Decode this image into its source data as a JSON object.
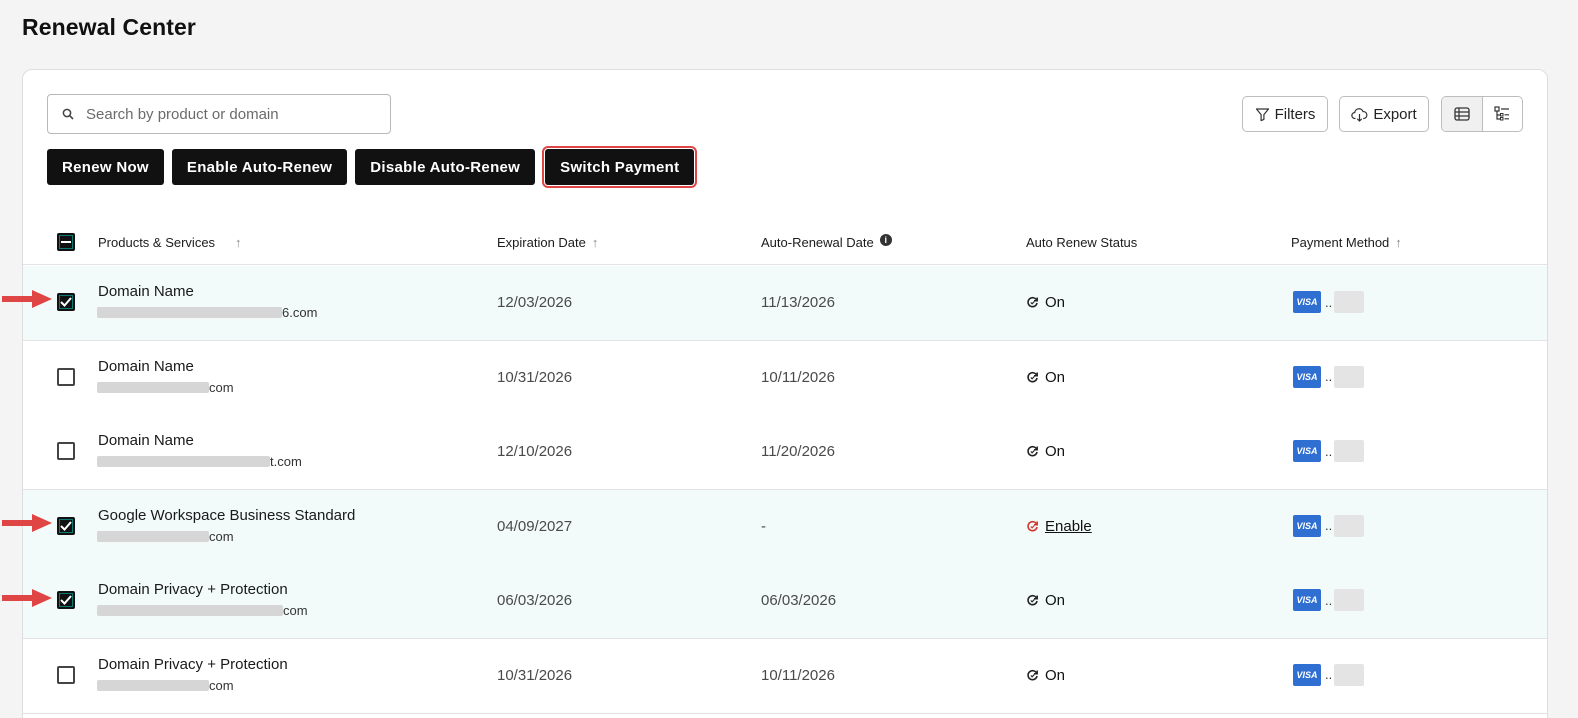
{
  "page": {
    "title": "Renewal Center"
  },
  "search": {
    "placeholder": "Search by product or domain",
    "icon": "search-icon"
  },
  "toolbar": {
    "filters_label": "Filters",
    "export_label": "Export"
  },
  "actions": {
    "renew_now": "Renew Now",
    "enable_auto_renew": "Enable Auto-Renew",
    "disable_auto_renew": "Disable Auto-Renew",
    "switch_payment": "Switch Payment"
  },
  "table": {
    "headers": {
      "product": "Products & Services",
      "expiration": "Expiration Date",
      "auto_renewal": "Auto-Renewal Date",
      "status": "Auto Renew Status",
      "payment": "Payment Method"
    },
    "rows": [
      {
        "product": "Domain Name",
        "suffix": "6.com",
        "expiration": "12/03/2026",
        "auto_renewal": "11/13/2026",
        "status": "On",
        "checked": true,
        "payment_brand": "VISA",
        "card_masked": ".."
      },
      {
        "product": "Domain Name",
        "suffix": "com",
        "expiration": "10/31/2026",
        "auto_renewal": "10/11/2026",
        "status": "On",
        "checked": false,
        "payment_brand": "VISA",
        "card_masked": ".."
      },
      {
        "product": "Domain Name",
        "suffix": "t.com",
        "expiration": "12/10/2026",
        "auto_renewal": "11/20/2026",
        "status": "On",
        "checked": false,
        "payment_brand": "VISA",
        "card_masked": ".."
      },
      {
        "product": "Google Workspace Business Standard",
        "suffix": "com",
        "expiration": "04/09/2027",
        "auto_renewal": "-",
        "status": "Enable",
        "checked": true,
        "payment_brand": "VISA",
        "card_masked": ".."
      },
      {
        "product": "Domain Privacy + Protection",
        "suffix": "com",
        "expiration": "06/03/2026",
        "auto_renewal": "06/03/2026",
        "status": "On",
        "checked": true,
        "payment_brand": "VISA",
        "card_masked": ".."
      },
      {
        "product": "Domain Privacy + Protection",
        "suffix": "com",
        "expiration": "10/31/2026",
        "auto_renewal": "10/11/2026",
        "status": "On",
        "checked": false,
        "payment_brand": "VISA",
        "card_masked": ".."
      }
    ]
  },
  "colors": {
    "accent_dark": "#111111",
    "selected_row": "#f2fbf9",
    "visa_blue": "#2f6fd2",
    "annotation_red": "#e04545",
    "status_disabled_red": "#d0342c"
  }
}
